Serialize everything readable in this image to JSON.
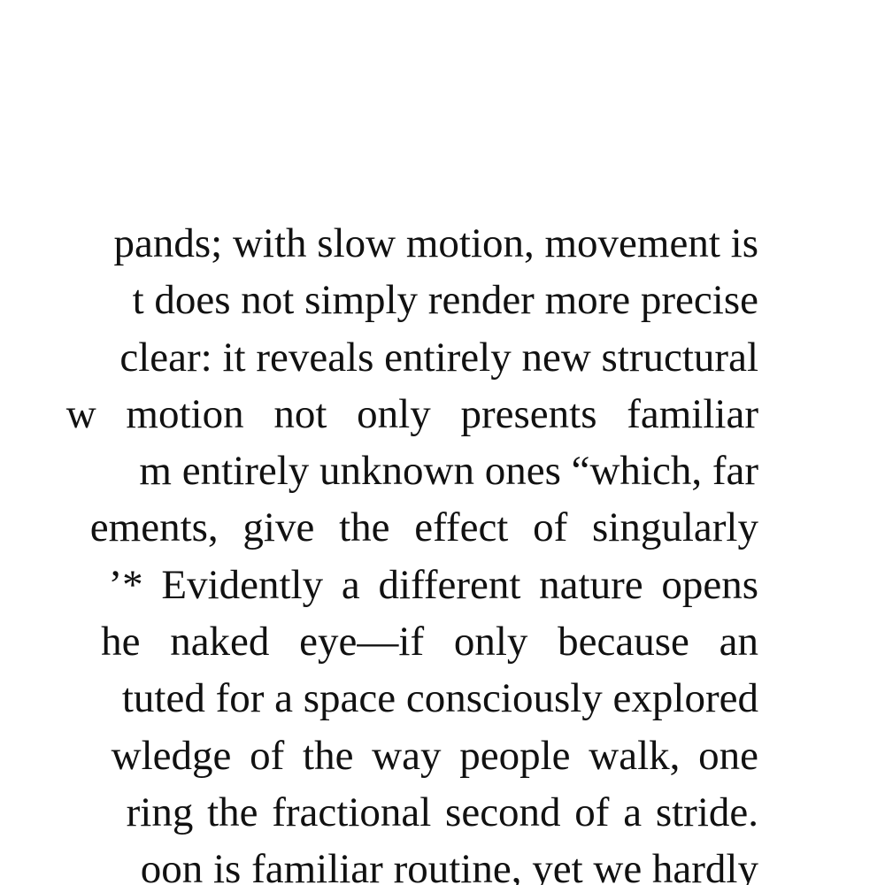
{
  "document": {
    "lines": [
      "pands; with slow motion, movement is",
      "t does not simply render more precise",
      "clear: it reveals entirely new structural",
      "w motion not only presents familiar",
      "m entirely unknown ones “which, far",
      "ements, give the effect of singularly",
      "’* Evidently a different nature opens",
      "he naked eye—if only because an",
      "tuted for a space consciously explored",
      "wledge of the way people walk, one",
      "ring the fractional second of a stride.",
      "oon is familiar routine, yet we hardly"
    ]
  }
}
